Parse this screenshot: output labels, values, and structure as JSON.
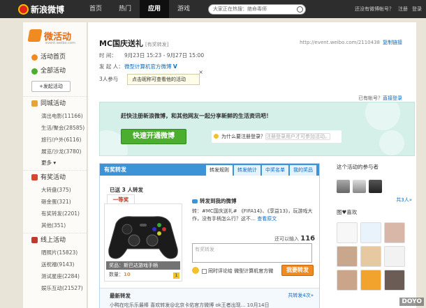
{
  "topbar": {
    "logo_text": "新浪微博",
    "nav": [
      "首页",
      "热门",
      "应用",
      "游戏"
    ],
    "search_placeholder": "大家正在热搜：绝命毒师",
    "links": [
      "还没有微博帐号？",
      "注册",
      "登录"
    ]
  },
  "sidebar": {
    "brand_title": "微活动",
    "brand_sub": "event.weibo.com",
    "home": "活动首页",
    "all": "全部活动",
    "post_button": "+发起活动",
    "city": {
      "title": "同城活动",
      "items": [
        "演出电影(11166)",
        "生活/聚会(28585)",
        "旅行/户外(6116)",
        "展览/沙龙(3780)"
      ],
      "more": "更多"
    },
    "prize": {
      "title": "有奖活动",
      "items": [
        "大转盘(375)",
        "砸金蛋(321)",
        "有奖转发(2201)",
        "其他(351)"
      ]
    },
    "online": {
      "title": "线上活动",
      "items": [
        "晒照片(15823)",
        "送祝福(9143)",
        "测试星座(2284)",
        "娱乐互动(21527)"
      ]
    }
  },
  "event": {
    "title": "MC国庆送礼",
    "type_tag": "[有奖转发]",
    "url": "http://event.weibo.com/2110438",
    "copy_link": "复制链接",
    "time_label": "时    间：",
    "time_value": "9月23日 15:23 - 9月27日 15:00",
    "host_label": "发 起 人：",
    "host_value": "微型计算机官方微博",
    "participants": "3人参与",
    "popup": "点击昵称可查看他的活动",
    "popup_close": "×"
  },
  "banner": {
    "login_hint_prefix": "已有帐号？",
    "login_hint_link": "直接登录",
    "message": "赶快注册新浪微博，和其他网友一起分享新鲜的生活资讯吧！",
    "register_button": "快速开通微博",
    "why_text": "为什么要注册登录？",
    "why_grey": "注册登录用户才可参加活动。"
  },
  "panel": {
    "title": "有奖转发",
    "tabs": [
      "转发规则",
      "转发统计",
      "中奖名单",
      "我的奖品"
    ],
    "won_count": "已送 3 人转发",
    "first_prize": "一等奖",
    "prize_caption": "奖品：斯巴达游戏手柄",
    "prize_qty_label": "数量：",
    "prize_qty": "10",
    "prize_badge": "1",
    "forward_title": "转发到我的微博",
    "forward_text": "转：#MC国庆送礼# 《FIFA14》、《享益13》，玩游戏大作，没有手柄怎么行？这不… ",
    "forward_link": "查看原文",
    "remain_prefix": "还可以输入",
    "remain_count": "116",
    "remain_suffix": "字",
    "textarea_placeholder": "有奖转发",
    "checkbox_label": "同时评论给",
    "checkbox_target": "微型计算机官方微",
    "send_button": "我要转发",
    "newest_title": "最新转发",
    "newest_more": "共转发4次»",
    "newest_row": "小鸭在吃乐乐最棒    喜欢转发@北京卡佑官方微博 ok王者出现...    10月14日"
  },
  "right": {
    "participants_title": "这个活动的参与者",
    "participants_more": "共3人»",
    "likes_title": "图♥喜欢"
  },
  "watermark": "DOYO"
}
